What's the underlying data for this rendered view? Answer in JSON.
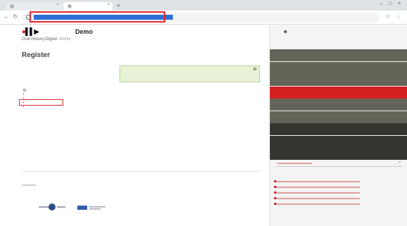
{
  "browser": {
    "tabs": [
      {
        "label": ""
      },
      {
        "label": ""
      }
    ],
    "url": ""
  },
  "site": {
    "logo_name": "Oral-History.Digital",
    "logo_demo": "Demo",
    "logo_archiv": "Archiv"
  },
  "main": {
    "page_title": "Register",
    "notice_text": "",
    "notice_link": "",
    "tree_items": [
      {
        "label": ""
      },
      {
        "label": ""
      },
      {
        "label": ""
      },
      {
        "label": ""
      },
      {
        "label": ""
      },
      {
        "label": ""
      }
    ],
    "footer_links": ""
  },
  "panel": {
    "label": "",
    "menu": [
      {
        "label": ""
      },
      {
        "label": ""
      },
      {
        "label": ""
      },
      {
        "label": ""
      },
      {
        "label": ""
      },
      {
        "label": ""
      },
      {
        "label": ""
      },
      {
        "label": ""
      },
      {
        "label": ""
      },
      {
        "label": ""
      }
    ],
    "register_label": "",
    "list_label": ""
  },
  "colors": {
    "brand_red": "#d41f1f",
    "menu_olive": "#646459",
    "menu_dark": "#34352e",
    "highlight": "#e0292f",
    "notice_bg": "#e7f2d8"
  },
  "icons": {
    "logo": "record-play-icon",
    "notice": "close-icon",
    "tree_expand": "plus-icon",
    "register_clear": "close-icon"
  }
}
